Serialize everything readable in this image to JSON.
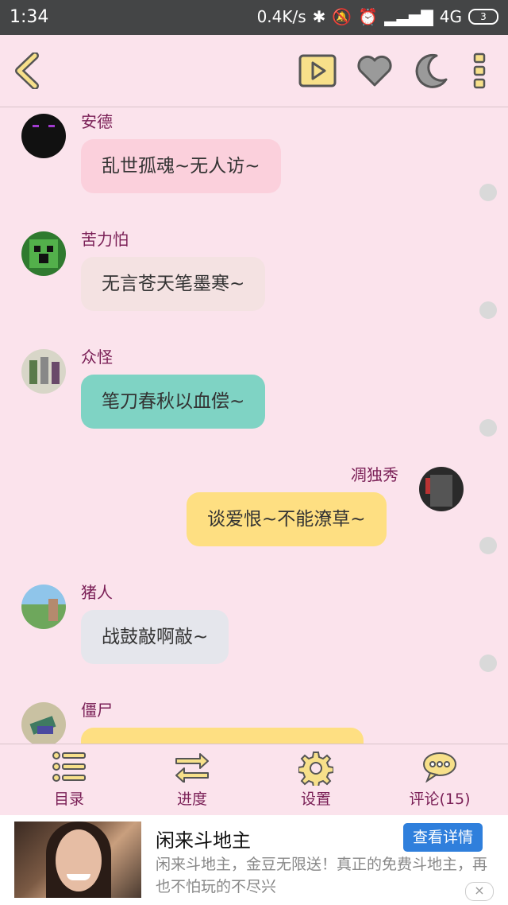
{
  "status_bar": {
    "time": "1:34",
    "speed": "0.4K/s",
    "network": "4G",
    "battery": "3"
  },
  "toolbar": {
    "icons": [
      "back-arrow-icon",
      "play-icon",
      "heart-icon",
      "moon-icon",
      "more-vertical-icon"
    ],
    "accent_color": "#f7e08a"
  },
  "chat": {
    "messages": [
      {
        "speaker": "安德",
        "text": "乱世孤魂~无人访~",
        "side": "left",
        "bubble_color": "#fbd0dc"
      },
      {
        "speaker": "苦力怕",
        "text": "无言苍天笔墨寒~",
        "side": "left",
        "bubble_color": "#f4e2e2"
      },
      {
        "speaker": "众怪",
        "text": "笔刀春秋以血偿~",
        "side": "left",
        "bubble_color": "#7fd3c4"
      },
      {
        "speaker": "凋独秀",
        "text": "谈爱恨~不能潦草~",
        "side": "right",
        "bubble_color": "#fedf82"
      },
      {
        "speaker": "猪人",
        "text": "战鼓敲啊敲~",
        "side": "left",
        "bubble_color": "#e5e6ec"
      },
      {
        "speaker": "僵尸",
        "text": "",
        "side": "left",
        "bubble_color": "#fedf82"
      }
    ]
  },
  "bottom_nav": {
    "catalog": "目录",
    "progress": "进度",
    "settings": "设置",
    "comments": "评论(15)"
  },
  "ad": {
    "title": "闲来斗地主",
    "description": "闲来斗地主，金豆无限送！真正的免费斗地主，再也不怕玩的不尽兴",
    "cta": "查看详情",
    "close": "×"
  }
}
